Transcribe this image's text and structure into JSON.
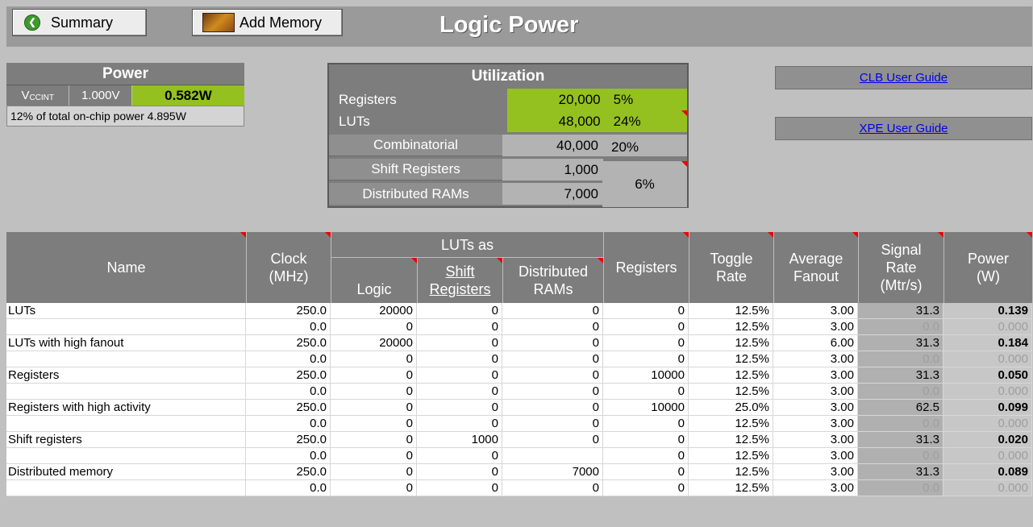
{
  "header": {
    "summary_label": "Summary",
    "add_memory_label": "Add Memory",
    "title": "Logic Power"
  },
  "power": {
    "title": "Power",
    "rail": "V",
    "rail_sub": "CCINT",
    "voltage": "1.000V",
    "watts": "0.582W",
    "note": "12% of total on-chip power 4.895W"
  },
  "utilization": {
    "title": "Utilization",
    "registers": {
      "label": "Registers",
      "value": "20,000",
      "pct": "5%"
    },
    "luts": {
      "label": "LUTs",
      "value": "48,000",
      "pct": "24%"
    },
    "combinatorial": {
      "label": "Combinatorial",
      "value": "40,000",
      "pct": "20%"
    },
    "shift": {
      "label": "Shift Registers",
      "value": "1,000"
    },
    "dram": {
      "label": "Distributed RAMs",
      "value": "7,000"
    },
    "shift_dram_pct": "6%"
  },
  "links": {
    "clb": "CLB User Guide",
    "xpe": "XPE User Guide"
  },
  "table": {
    "headers": {
      "name": "Name",
      "clock": "Clock (MHz)",
      "luts_as": "LUTs as",
      "logic": "Logic",
      "shift": "Shift Registers",
      "dram": "Distributed RAMs",
      "registers": "Registers",
      "toggle": "Toggle Rate",
      "fanout": "Average Fanout",
      "signal": "Signal Rate (Mtr/s)",
      "power": "Power (W)"
    },
    "rows": [
      [
        "LUTs",
        "250.0",
        "20000",
        "0",
        "0",
        "0",
        "12.5%",
        "3.00",
        "31.3",
        "0.139"
      ],
      [
        "",
        "0.0",
        "0",
        "0",
        "0",
        "0",
        "12.5%",
        "3.00",
        "0.0",
        "0.000"
      ],
      [
        "LUTs with high fanout",
        "250.0",
        "20000",
        "0",
        "0",
        "0",
        "12.5%",
        "6.00",
        "31.3",
        "0.184"
      ],
      [
        "",
        "0.0",
        "0",
        "0",
        "0",
        "0",
        "12.5%",
        "3.00",
        "0.0",
        "0.000"
      ],
      [
        "Registers",
        "250.0",
        "0",
        "0",
        "0",
        "10000",
        "12.5%",
        "3.00",
        "31.3",
        "0.050"
      ],
      [
        "",
        "0.0",
        "0",
        "0",
        "0",
        "0",
        "12.5%",
        "3.00",
        "0.0",
        "0.000"
      ],
      [
        "Registers with high activity",
        "250.0",
        "0",
        "0",
        "0",
        "10000",
        "25.0%",
        "3.00",
        "62.5",
        "0.099"
      ],
      [
        "",
        "0.0",
        "0",
        "0",
        "0",
        "0",
        "12.5%",
        "3.00",
        "0.0",
        "0.000"
      ],
      [
        "Shift registers",
        "250.0",
        "0",
        "1000",
        "0",
        "0",
        "12.5%",
        "3.00",
        "31.3",
        "0.020"
      ],
      [
        "",
        "0.0",
        "0",
        "0",
        "",
        "0",
        "12.5%",
        "3.00",
        "0.0",
        "0.000"
      ],
      [
        "Distributed memory",
        "250.0",
        "0",
        "0",
        "7000",
        "0",
        "12.5%",
        "3.00",
        "31.3",
        "0.089"
      ],
      [
        "",
        "0.0",
        "0",
        "0",
        "0",
        "0",
        "12.5%",
        "3.00",
        "0.0",
        "0.000"
      ]
    ]
  }
}
